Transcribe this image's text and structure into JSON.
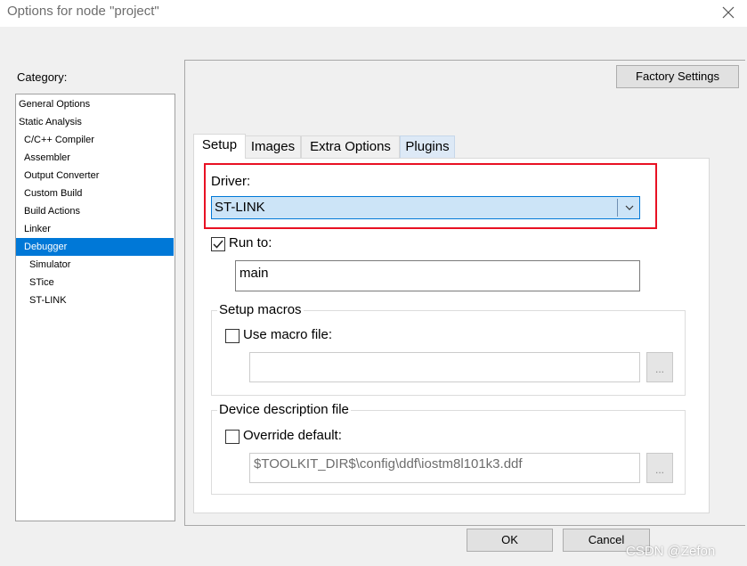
{
  "window": {
    "title": "Options for node \"project\""
  },
  "category": {
    "label": "Category:",
    "items": [
      {
        "label": "General Options"
      },
      {
        "label": "Static Analysis"
      },
      {
        "label": "C/C++ Compiler"
      },
      {
        "label": "Assembler"
      },
      {
        "label": "Output Converter"
      },
      {
        "label": "Custom Build"
      },
      {
        "label": "Build Actions"
      },
      {
        "label": "Linker"
      },
      {
        "label": "Debugger"
      },
      {
        "label": "Simulator"
      },
      {
        "label": "STice"
      },
      {
        "label": "ST-LINK"
      }
    ],
    "selected": "Debugger"
  },
  "toolbar": {
    "factory_settings": "Factory Settings"
  },
  "tabs": [
    {
      "label": "Setup",
      "active": true
    },
    {
      "label": "Images"
    },
    {
      "label": "Extra Options"
    },
    {
      "label": "Plugins"
    }
  ],
  "setup": {
    "driver_label": "Driver:",
    "driver_value": "ST-LINK",
    "run_to_label": "Run to:",
    "run_to_checked": true,
    "run_to_value": "main",
    "setup_macros_title": "Setup macros",
    "use_macro_label": "Use macro file:",
    "use_macro_checked": false,
    "macro_file_value": "",
    "device_title": "Device description file",
    "override_label": "Override default:",
    "override_checked": false,
    "device_file_value": "$TOOLKIT_DIR$\\config\\ddf\\iostm8l101k3.ddf",
    "browse_label": "..."
  },
  "buttons": {
    "ok": "OK",
    "cancel": "Cancel"
  },
  "watermark": "CSDN @Zefon",
  "colors": {
    "selection": "#0078d7",
    "highlight_box": "#e81123",
    "driver_bg": "#cce4f7"
  }
}
